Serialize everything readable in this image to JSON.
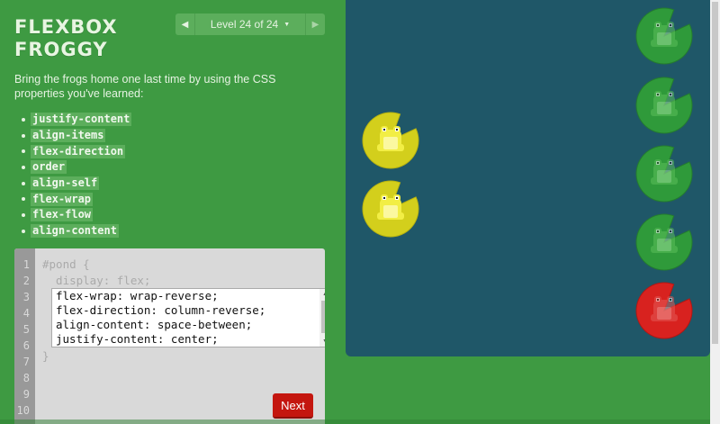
{
  "app": {
    "title_line1": "FLEXBOX",
    "title_line2": "FROGGY"
  },
  "level_nav": {
    "prev_icon": "triangle-left-icon",
    "next_icon": "triangle-right-icon",
    "label": "Level 24 of 24",
    "dropdown_icon": "caret-down-icon",
    "prev_glyph": "◀",
    "next_glyph": "▶",
    "caret_glyph": "▼"
  },
  "instructions": "Bring the frogs home one last time by using the CSS properties you've learned:",
  "properties": [
    "justify-content",
    "align-items",
    "flex-direction",
    "order",
    "align-self",
    "flex-wrap",
    "flex-flow",
    "align-content"
  ],
  "editor": {
    "line_numbers": [
      "1",
      "2",
      "3",
      "4",
      "5",
      "6",
      "7",
      "8",
      "9",
      "10"
    ],
    "line1": "#pond {",
    "line2": "  display: flex;",
    "input_value": "flex-wrap: wrap-reverse;\nflex-direction: column-reverse;\nalign-content: space-between;\njustify-content: center;",
    "closing": "}",
    "next_label": "Next"
  },
  "colors": {
    "background": "#3e9a42",
    "pond": "#1f5768",
    "frog_yellow": "#e6e02a",
    "frog_green": "#2f9a3a",
    "frog_red": "#d8221f",
    "next_button": "#c4160f"
  },
  "pond_items": [
    {
      "kind": "frog",
      "color": "yellow"
    },
    {
      "kind": "frog",
      "color": "yellow"
    },
    {
      "kind": "lilypad",
      "color": "green"
    },
    {
      "kind": "lilypad",
      "color": "green"
    },
    {
      "kind": "lilypad",
      "color": "green"
    },
    {
      "kind": "lilypad",
      "color": "green"
    },
    {
      "kind": "lilypad",
      "color": "red"
    }
  ]
}
